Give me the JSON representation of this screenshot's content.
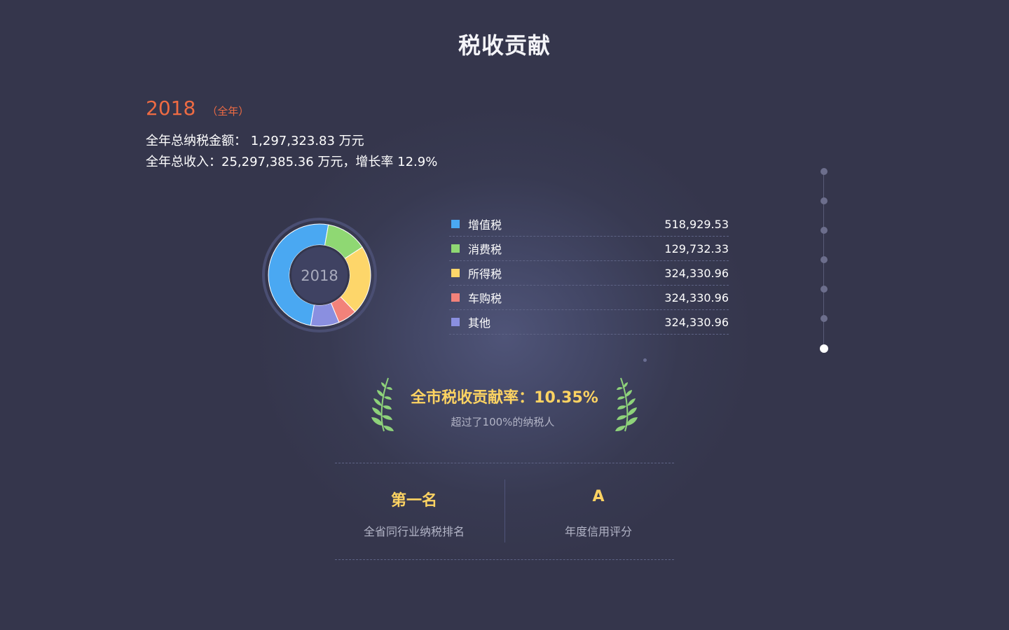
{
  "page": {
    "title": "税收贡献"
  },
  "summary": {
    "year": "2018",
    "year_note": "（全年）",
    "total_tax_line": "全年总纳税金额： 1,297,323.83 万元",
    "total_income_line": "全年总收入：25,297,385.36 万元，增长率 12.9%"
  },
  "chart_data": {
    "type": "pie",
    "center_label": "2018",
    "categories": [
      "增值税",
      "消费税",
      "所得税",
      "车购税",
      "其他"
    ],
    "values": [
      518929.53,
      129732.33,
      324330.96,
      324330.96,
      324330.96
    ],
    "value_labels": [
      "518,929.53",
      "129,732.33",
      "324,330.96",
      "324,330.96",
      "324,330.96"
    ],
    "displayed_slices": [
      50,
      13,
      22,
      6,
      9
    ],
    "colors": [
      "#4aa8f2",
      "#8fd873",
      "#fdd66a",
      "#f2827a",
      "#8a8fe0"
    ]
  },
  "rate": {
    "title": "全市税收贡献率：10.35%",
    "subtitle": "超过了100%的纳税人"
  },
  "stats": [
    {
      "value": "第一名",
      "label": "全省同行业纳税排名"
    },
    {
      "value": "A",
      "label": "年度信用评分"
    }
  ],
  "nav": {
    "count": 7,
    "active_index": 6
  },
  "colors": {
    "accent_orange": "#ee6b43",
    "accent_gold": "#fdd362",
    "background": "#383a52",
    "laurel_green": "#8ed27a"
  },
  "icons": {
    "laurel": "laurel-branch-icon"
  }
}
